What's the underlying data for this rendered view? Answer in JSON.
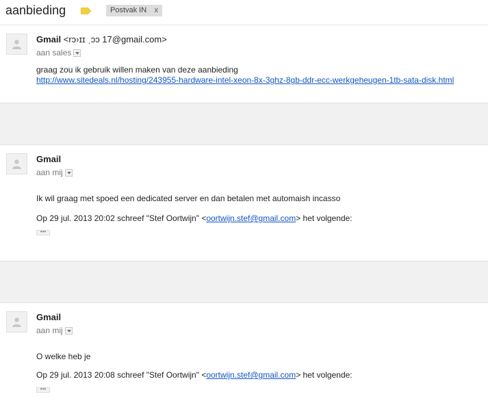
{
  "thread": {
    "subject": "aanbieding",
    "label": "Postvak IN",
    "label_remove": "x"
  },
  "messages": [
    {
      "sender_name": "Gmail",
      "sender_addr": "<rɔ›ɪɪ ˌɔɔ 17@gmail.com>",
      "recipient": "aan sales",
      "body_line1": "graag zou ik gebruik willen maken van deze aanbieding",
      "body_link": "http://www.sitedeals.nl/hosting/243955-hardware-intel-xeon-8x-3ghz-8gb-ddr-ecc-werkgeheugen-1tb-sata-disk.html"
    },
    {
      "sender_name": "Gmail",
      "recipient": "aan mij",
      "body": "Ik wil graag met spoed een dedicated server en dan betalen met automaish incasso",
      "quote_prefix": "Op 29 jul. 2013 20:02 schreef \"Stef Oortwijn\" <",
      "quote_email": "oortwijn.stef@gmail.com",
      "quote_suffix": "> het volgende:",
      "ellipsis": "•••"
    },
    {
      "sender_name": "Gmail",
      "recipient": "aan mij",
      "body": "O welke heb je",
      "quote_prefix": "Op 29 jul. 2013 20:08 schreef \"Stef Oortwijn\" <",
      "quote_email": "oortwijn.stef@gmail.com",
      "quote_suffix": "> het volgende:",
      "ellipsis": "•••"
    }
  ],
  "icons": {
    "importance": "importance-marker-icon",
    "avatar": "default-avatar-icon",
    "dropdown": "details-dropdown-icon"
  },
  "colors": {
    "importance": "#f4d03f",
    "link": "#1155cc",
    "label_bg": "#dddddd",
    "band_bg": "#f1f1f1"
  }
}
